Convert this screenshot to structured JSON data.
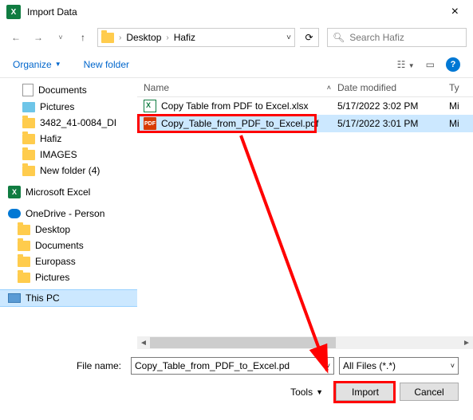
{
  "titlebar": {
    "title": "Import Data"
  },
  "nav": {
    "path_segment1": "Desktop",
    "path_segment2": "Hafiz"
  },
  "search": {
    "placeholder": "Search Hafiz"
  },
  "toolbar": {
    "organize": "Organize",
    "new_folder": "New folder"
  },
  "tree": {
    "items": [
      {
        "label": "Documents",
        "icon": "doc"
      },
      {
        "label": "Pictures",
        "icon": "pic"
      },
      {
        "label": "3482_41-0084_DI",
        "icon": "folder"
      },
      {
        "label": "Hafiz",
        "icon": "folder"
      },
      {
        "label": "IMAGES",
        "icon": "folder"
      },
      {
        "label": "New folder (4)",
        "icon": "folder"
      }
    ],
    "excel": "Microsoft Excel",
    "onedrive": "OneDrive - Person",
    "onedrive_children": [
      "Desktop",
      "Documents",
      "Europass",
      "Pictures"
    ],
    "thispc": "This PC"
  },
  "filelist": {
    "headers": {
      "name": "Name",
      "date": "Date modified",
      "type": "Ty"
    },
    "rows": [
      {
        "icon": "xlsx",
        "name": "Copy Table from PDF to Excel.xlsx",
        "date": "5/17/2022 3:02 PM",
        "type": "Mi",
        "selected": false
      },
      {
        "icon": "pdf",
        "name": "Copy_Table_from_PDF_to_Excel.pdf",
        "date": "5/17/2022 3:01 PM",
        "type": "Mi",
        "selected": true
      }
    ]
  },
  "footer": {
    "filename_label": "File name:",
    "filename_value": "Copy_Table_from_PDF_to_Excel.pd",
    "filetype": "All Files (*.*)",
    "tools": "Tools",
    "import": "Import",
    "cancel": "Cancel"
  }
}
